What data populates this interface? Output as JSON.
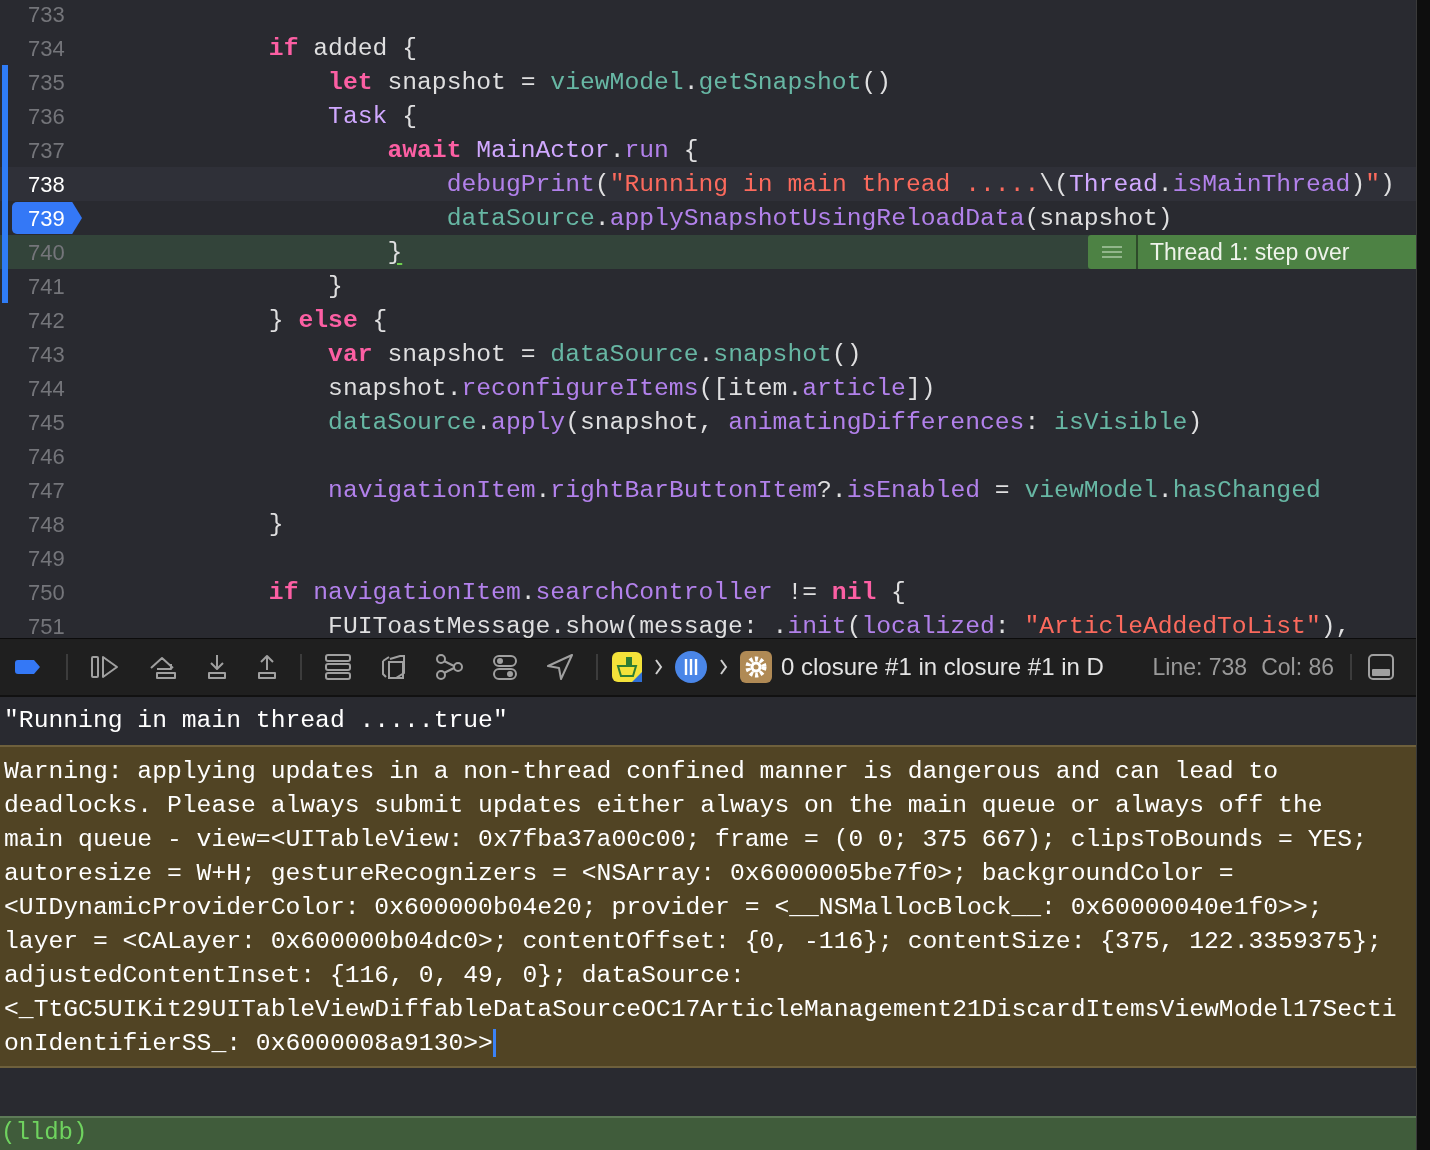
{
  "editor": {
    "lines": [
      {
        "number": "733",
        "changed": false,
        "current": false,
        "breakpoint": false,
        "stopped": false
      },
      {
        "number": "734",
        "changed": false,
        "current": false,
        "breakpoint": false,
        "stopped": false,
        "tokens": [
          {
            "kind": "keyword",
            "text": "if"
          },
          {
            "kind": "plain",
            "text": " added {"
          }
        ],
        "children": [
          {
            "number": "735",
            "changed": true,
            "current": false,
            "breakpoint": false,
            "stopped": false,
            "tokens": [
              {
                "kind": "keyword",
                "text": "let"
              },
              {
                "kind": "plain",
                "text": " snapshot = "
              },
              {
                "kind": "project",
                "text": "viewModel"
              },
              {
                "kind": "plain",
                "text": "."
              },
              {
                "kind": "project",
                "text": "getSnapshot"
              },
              {
                "kind": "plain",
                "text": "()"
              }
            ]
          },
          {
            "number": "736",
            "changed": true,
            "current": false,
            "breakpoint": false,
            "stopped": false,
            "tokens": [
              {
                "kind": "type",
                "text": "Task"
              },
              {
                "kind": "plain",
                "text": " {"
              }
            ],
            "children": [
              {
                "number": "737",
                "changed": true,
                "current": false,
                "breakpoint": false,
                "stopped": false,
                "tokens": [
                  {
                    "kind": "keyword",
                    "text": "await "
                  },
                  {
                    "kind": "type",
                    "text": "MainActor"
                  },
                  {
                    "kind": "plain",
                    "text": "."
                  },
                  {
                    "kind": "method",
                    "text": "run"
                  },
                  {
                    "kind": "plain",
                    "text": " {"
                  }
                ],
                "children": [
                  {
                    "number": "738",
                    "changed": true,
                    "current": true,
                    "breakpoint": false,
                    "stopped": false,
                    "tokens": [
                      {
                        "kind": "method",
                        "text": "debugPrint"
                      },
                      {
                        "kind": "plain",
                        "text": "("
                      },
                      {
                        "kind": "string",
                        "text": "\"Running in main thread ....."
                      },
                      {
                        "kind": "plain",
                        "text": "\\("
                      },
                      {
                        "kind": "type",
                        "text": "Thread"
                      },
                      {
                        "kind": "plain",
                        "text": "."
                      },
                      {
                        "kind": "method",
                        "text": "isMainThread"
                      },
                      {
                        "kind": "plain",
                        "text": ")"
                      },
                      {
                        "kind": "string",
                        "text": "\""
                      },
                      {
                        "kind": "plain",
                        "text": ")"
                      }
                    ]
                  },
                  {
                    "number": "739",
                    "changed": true,
                    "current": false,
                    "breakpoint": true,
                    "stopped": false,
                    "tokens": [
                      {
                        "kind": "project",
                        "text": "dataSource"
                      },
                      {
                        "kind": "plain",
                        "text": "."
                      },
                      {
                        "kind": "method",
                        "text": "applySnapshotUsingReloadData"
                      },
                      {
                        "kind": "plain",
                        "text": "(snapshot)"
                      }
                    ]
                  }
                ]
              },
              {
                "number": "740",
                "changed": true,
                "current": false,
                "breakpoint": false,
                "stopped": true,
                "annotation": "Thread 1: step over",
                "tokens": [
                  {
                    "kind": "marked",
                    "text": "}"
                  }
                ]
              }
            ]
          },
          {
            "number": "741",
            "changed": true,
            "current": false,
            "breakpoint": false,
            "stopped": false,
            "tokens": [
              {
                "kind": "plain",
                "text": "}"
              }
            ]
          }
        ]
      },
      {
        "number": "742",
        "changed": false,
        "current": false,
        "breakpoint": false,
        "stopped": false,
        "tokens": [
          {
            "kind": "plain",
            "text": "} "
          },
          {
            "kind": "keyword",
            "text": "else"
          },
          {
            "kind": "plain",
            "text": " {"
          }
        ],
        "children": [
          {
            "number": "743",
            "changed": false,
            "current": false,
            "breakpoint": false,
            "stopped": false,
            "tokens": [
              {
                "kind": "keyword",
                "text": "var"
              },
              {
                "kind": "plain",
                "text": " snapshot = "
              },
              {
                "kind": "project",
                "text": "dataSource"
              },
              {
                "kind": "plain",
                "text": "."
              },
              {
                "kind": "project",
                "text": "snapshot"
              },
              {
                "kind": "plain",
                "text": "()"
              }
            ]
          },
          {
            "number": "744",
            "changed": false,
            "current": false,
            "breakpoint": false,
            "stopped": false,
            "tokens": [
              {
                "kind": "plain",
                "text": "snapshot."
              },
              {
                "kind": "method",
                "text": "reconfigureItems"
              },
              {
                "kind": "plain",
                "text": "([item."
              },
              {
                "kind": "method",
                "text": "article"
              },
              {
                "kind": "plain",
                "text": "])"
              }
            ]
          },
          {
            "number": "745",
            "changed": false,
            "current": false,
            "breakpoint": false,
            "stopped": false,
            "tokens": [
              {
                "kind": "project",
                "text": "dataSource"
              },
              {
                "kind": "plain",
                "text": "."
              },
              {
                "kind": "method",
                "text": "apply"
              },
              {
                "kind": "plain",
                "text": "(snapshot, "
              },
              {
                "kind": "method",
                "text": "animatingDifferences"
              },
              {
                "kind": "plain",
                "text": ": "
              },
              {
                "kind": "project",
                "text": "isVisible"
              },
              {
                "kind": "plain",
                "text": ")"
              }
            ]
          },
          {
            "number": "746",
            "changed": false,
            "current": false,
            "breakpoint": false,
            "stopped": false
          },
          {
            "number": "747",
            "changed": false,
            "current": false,
            "breakpoint": false,
            "stopped": false,
            "tokens": [
              {
                "kind": "method",
                "text": "navigationItem"
              },
              {
                "kind": "plain",
                "text": "."
              },
              {
                "kind": "method",
                "text": "rightBarButtonItem"
              },
              {
                "kind": "plain",
                "text": "?."
              },
              {
                "kind": "method",
                "text": "isEnabled"
              },
              {
                "kind": "plain",
                "text": " = "
              },
              {
                "kind": "project",
                "text": "viewModel"
              },
              {
                "kind": "plain",
                "text": "."
              },
              {
                "kind": "project",
                "text": "hasChanged"
              }
            ]
          }
        ]
      },
      {
        "number": "748",
        "changed": false,
        "current": false,
        "breakpoint": false,
        "stopped": false,
        "tokens": [
          {
            "kind": "plain",
            "text": "}"
          }
        ]
      },
      {
        "number": "749",
        "changed": false,
        "current": false,
        "breakpoint": false,
        "stopped": false
      },
      {
        "number": "750",
        "changed": false,
        "current": false,
        "breakpoint": false,
        "stopped": false,
        "tokens": [
          {
            "kind": "keyword",
            "text": "if "
          },
          {
            "kind": "method",
            "text": "navigationItem"
          },
          {
            "kind": "plain",
            "text": "."
          },
          {
            "kind": "method",
            "text": "searchController"
          },
          {
            "kind": "plain",
            "text": " != "
          },
          {
            "kind": "keyword",
            "text": "nil"
          },
          {
            "kind": "plain",
            "text": " {"
          }
        ],
        "children": [
          {
            "number": "751",
            "changed": false,
            "current": false,
            "breakpoint": false,
            "stopped": false,
            "tokens": [
              {
                "kind": "plain",
                "text": "FUIToastMessage.show(message: ."
              },
              {
                "kind": "method",
                "text": "init"
              },
              {
                "kind": "plain",
                "text": "("
              },
              {
                "kind": "method",
                "text": "localized"
              },
              {
                "kind": "plain",
                "text": ": "
              },
              {
                "kind": "string",
                "text": "\"ArticleAddedToList\""
              },
              {
                "kind": "plain",
                "text": "),"
              }
            ]
          }
        ]
      }
    ]
  },
  "debug_bar": {
    "buttons": [
      {
        "kind": "breakpoints",
        "on": true
      },
      {
        "kind": "continue"
      },
      {
        "kind": "step_over"
      },
      {
        "kind": "step_into"
      },
      {
        "kind": "step_out"
      },
      {
        "kind": "view_hierarchy"
      },
      {
        "kind": "memory_graph"
      },
      {
        "kind": "graph"
      },
      {
        "kind": "environment"
      },
      {
        "kind": "location"
      }
    ],
    "frame_label": "0 closure #1 in closure #1 in D",
    "line_label": "Line: 738",
    "col_label": "Col: 86"
  },
  "console": {
    "output": [
      "\"Running in main thread .....true\""
    ],
    "warning_lines": [
      "Warning: applying updates in a non-thread confined manner is dangerous and can lead to",
      "deadlocks. Please always submit updates either always on the main queue or always off the",
      "main queue - view=<UITableView: 0x7fba37a00c00; frame = (0 0; 375 667); clipsToBounds = YES;",
      "autoresize = W+H; gestureRecognizers = <NSArray: 0x6000005be7f0>; backgroundColor =",
      "<UIDynamicProviderColor: 0x600000b04e20; provider = <__NSMallocBlock__: 0x60000040e1f0>>;",
      "layer = <CALayer: 0x600000b04dc0>; contentOffset: {0, -116}; contentSize: {375, 122.3359375};",
      "adjustedContentInset: {116, 0, 49, 0}; dataSource:",
      "<_TtGC5UIKit29UITableViewDiffableDataSourceOC17ArticleManagement21DiscardItemsViewModel17Secti",
      "onIdentifierSS_: 0x6000008a9130>>"
    ],
    "prompt": "(lldb)"
  }
}
